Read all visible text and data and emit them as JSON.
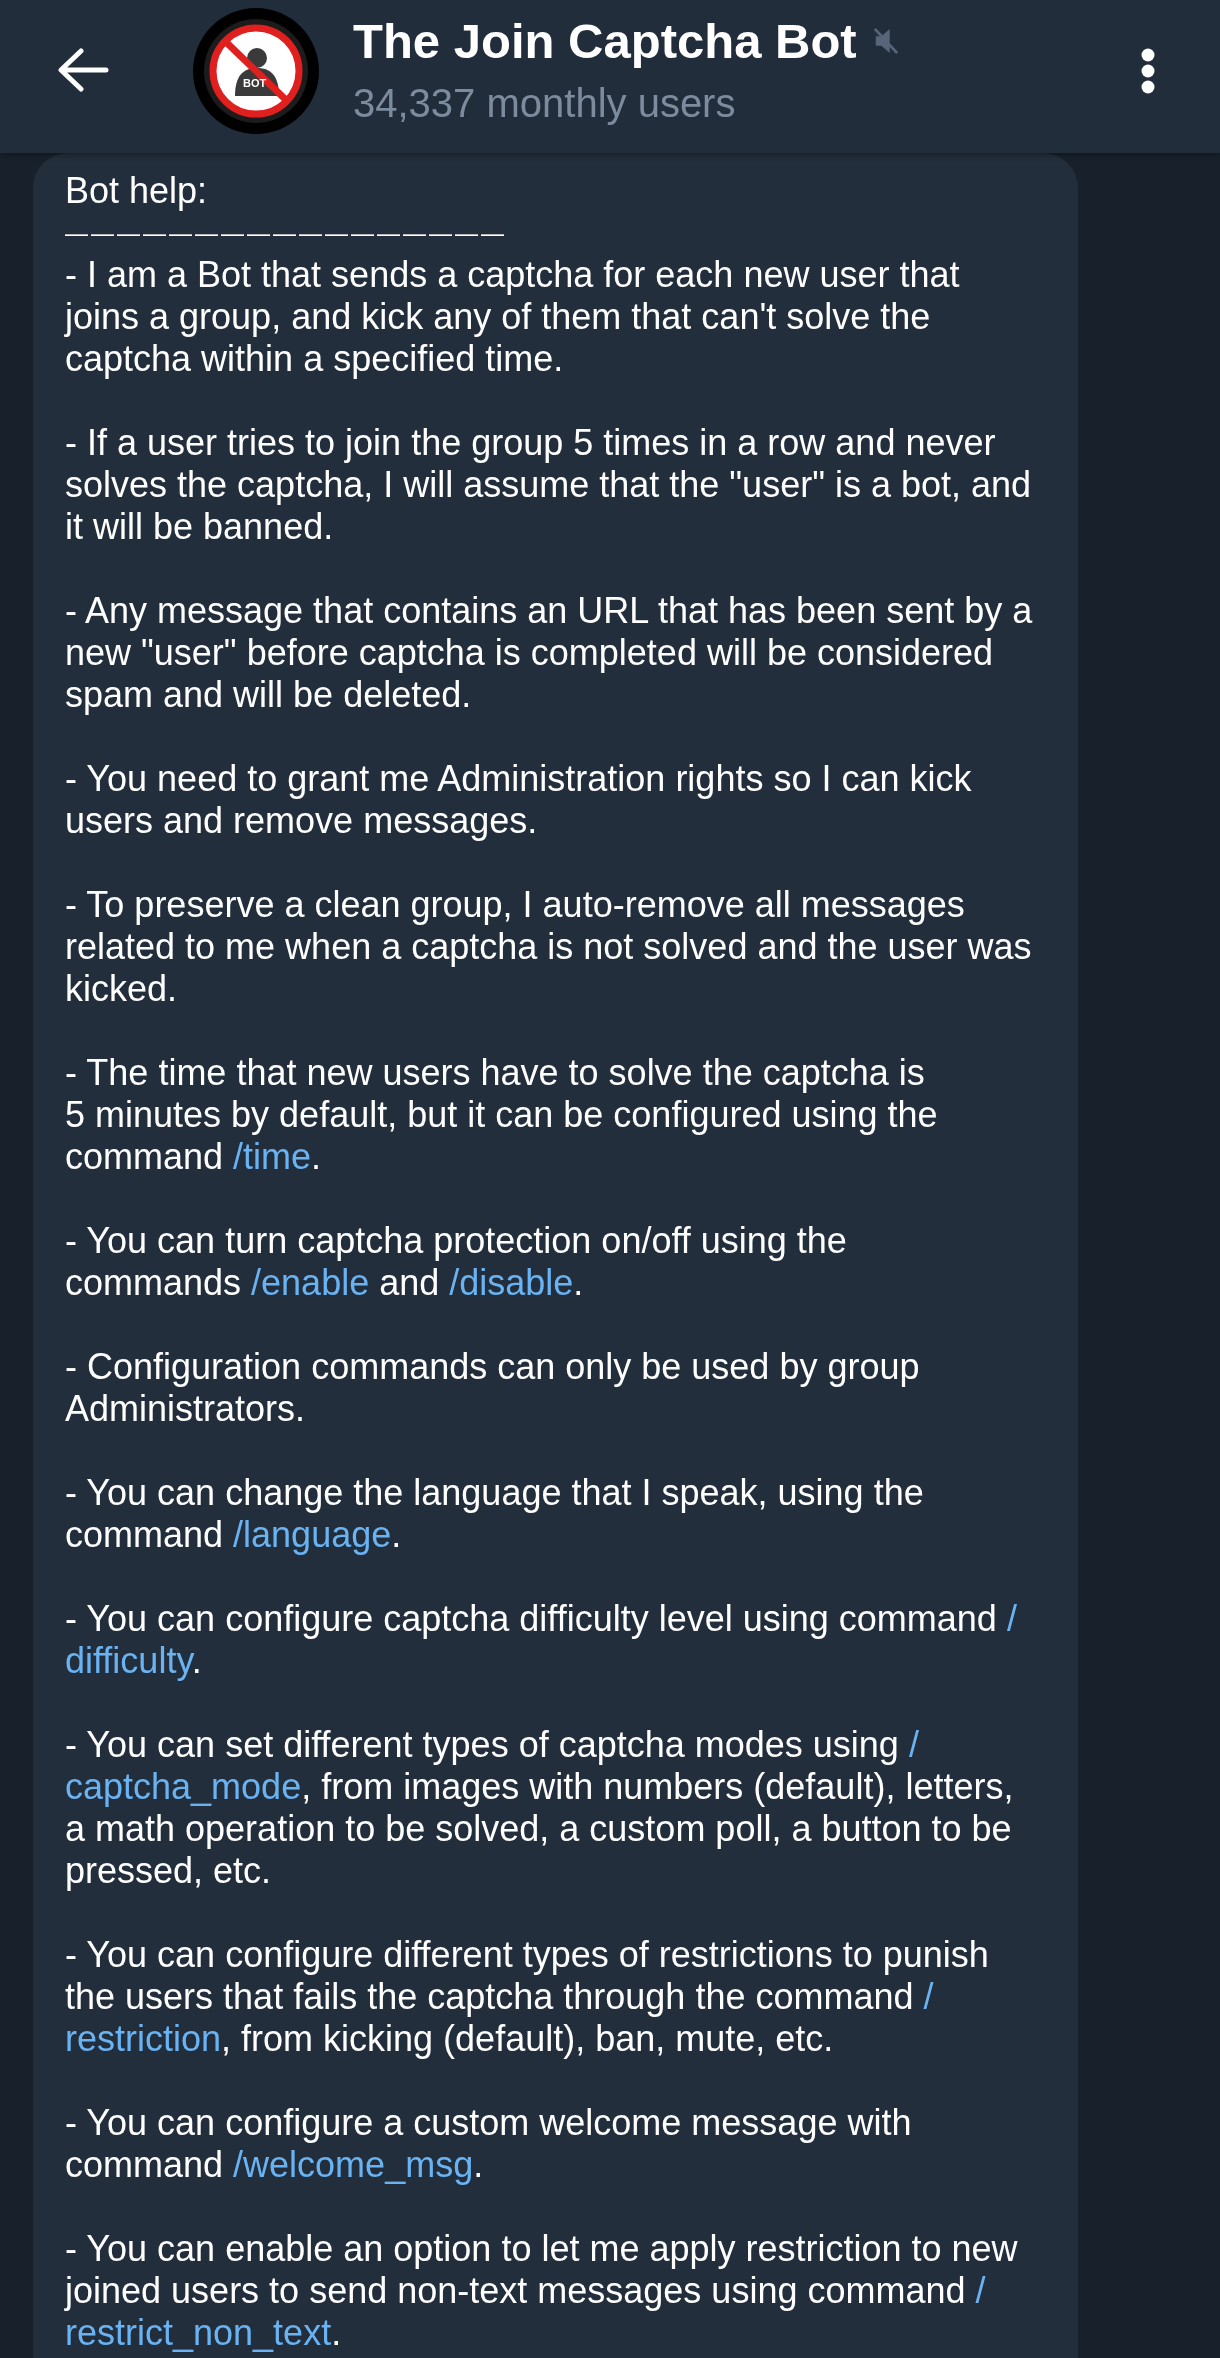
{
  "header": {
    "title": "The Join Captcha Bot",
    "muted": true,
    "subtitle": "34,337 monthly users",
    "avatar_label": "BOT"
  },
  "message": {
    "heading": "Bot help:",
    "divider": "—————————————————",
    "paragraphs": [
      {
        "lines": [
          [
            {
              "kind": "text",
              "text": "- I am a Bot that sends a captcha for each new user that"
            }
          ],
          [
            {
              "kind": "text",
              "text": "joins a group, and kick any of them that can't solve the"
            }
          ],
          [
            {
              "kind": "text",
              "text": "captcha within a specified time."
            }
          ]
        ]
      },
      {
        "lines": [
          [
            {
              "kind": "text",
              "text": "- If a user tries to join the group 5 times in a row and never"
            }
          ],
          [
            {
              "kind": "text",
              "text": "solves the captcha, I will assume that the \"user\" is a bot, and"
            }
          ],
          [
            {
              "kind": "text",
              "text": "it will be banned."
            }
          ]
        ]
      },
      {
        "lines": [
          [
            {
              "kind": "text",
              "text": "- Any message that contains an URL that has been sent by a"
            }
          ],
          [
            {
              "kind": "text",
              "text": "new \"user\" before captcha is completed will be considered"
            }
          ],
          [
            {
              "kind": "text",
              "text": "spam and will be deleted."
            }
          ]
        ]
      },
      {
        "lines": [
          [
            {
              "kind": "text",
              "text": "- You need to grant me Administration rights so I can kick"
            }
          ],
          [
            {
              "kind": "text",
              "text": "users and remove messages."
            }
          ]
        ]
      },
      {
        "lines": [
          [
            {
              "kind": "text",
              "text": "- To preserve a clean group, I auto-remove all messages"
            }
          ],
          [
            {
              "kind": "text",
              "text": "related to me when a captcha is not solved and the user was"
            }
          ],
          [
            {
              "kind": "text",
              "text": "kicked."
            }
          ]
        ]
      },
      {
        "lines": [
          [
            {
              "kind": "text",
              "text": "- The time that new users have to solve the captcha is"
            }
          ],
          [
            {
              "kind": "text",
              "text": "5 minutes by default, but it can be configured using the"
            }
          ],
          [
            {
              "kind": "text",
              "text": "command "
            },
            {
              "kind": "command",
              "text": "/time"
            },
            {
              "kind": "text",
              "text": "."
            }
          ]
        ]
      },
      {
        "lines": [
          [
            {
              "kind": "text",
              "text": "- You can turn captcha protection on/off using the"
            }
          ],
          [
            {
              "kind": "text",
              "text": "commands "
            },
            {
              "kind": "command",
              "text": "/enable"
            },
            {
              "kind": "text",
              "text": " and "
            },
            {
              "kind": "command",
              "text": "/disable"
            },
            {
              "kind": "text",
              "text": "."
            }
          ]
        ]
      },
      {
        "lines": [
          [
            {
              "kind": "text",
              "text": "- Configuration commands can only be used by group"
            }
          ],
          [
            {
              "kind": "text",
              "text": "Administrators."
            }
          ]
        ]
      },
      {
        "lines": [
          [
            {
              "kind": "text",
              "text": "- You can change the language that I speak, using the"
            }
          ],
          [
            {
              "kind": "text",
              "text": "command "
            },
            {
              "kind": "command",
              "text": "/language"
            },
            {
              "kind": "text",
              "text": "."
            }
          ]
        ]
      },
      {
        "lines": [
          [
            {
              "kind": "text",
              "text": "- You can configure captcha difficulty level using command "
            },
            {
              "kind": "command",
              "text": "/"
            }
          ],
          [
            {
              "kind": "command",
              "text": "difficulty"
            },
            {
              "kind": "text",
              "text": "."
            }
          ]
        ]
      },
      {
        "lines": [
          [
            {
              "kind": "text",
              "text": "- You can set different types of captcha modes using "
            },
            {
              "kind": "command",
              "text": "/"
            }
          ],
          [
            {
              "kind": "command",
              "text": "captcha_mode"
            },
            {
              "kind": "text",
              "text": ", from images with numbers (default), letters,"
            }
          ],
          [
            {
              "kind": "text",
              "text": "a math operation to be solved, a custom poll, a button to be"
            }
          ],
          [
            {
              "kind": "text",
              "text": "pressed, etc."
            }
          ]
        ]
      },
      {
        "lines": [
          [
            {
              "kind": "text",
              "text": "- You can configure different types of restrictions to punish"
            }
          ],
          [
            {
              "kind": "text",
              "text": "the users that fails the captcha through the command "
            },
            {
              "kind": "command",
              "text": "/"
            }
          ],
          [
            {
              "kind": "command",
              "text": "restriction"
            },
            {
              "kind": "text",
              "text": ", from kicking (default), ban, mute, etc."
            }
          ]
        ]
      },
      {
        "lines": [
          [
            {
              "kind": "text",
              "text": "- You can configure a custom welcome message with"
            }
          ],
          [
            {
              "kind": "text",
              "text": "command "
            },
            {
              "kind": "command",
              "text": "/welcome_msg"
            },
            {
              "kind": "text",
              "text": "."
            }
          ]
        ]
      },
      {
        "lines": [
          [
            {
              "kind": "text",
              "text": "- You can enable an option to let me apply restriction to new"
            }
          ],
          [
            {
              "kind": "text",
              "text": "joined users to send non-text messages using command "
            },
            {
              "kind": "command",
              "text": "/"
            }
          ],
          [
            {
              "kind": "command",
              "text": "restrict_non_text"
            },
            {
              "kind": "text",
              "text": "."
            }
          ]
        ]
      }
    ]
  }
}
